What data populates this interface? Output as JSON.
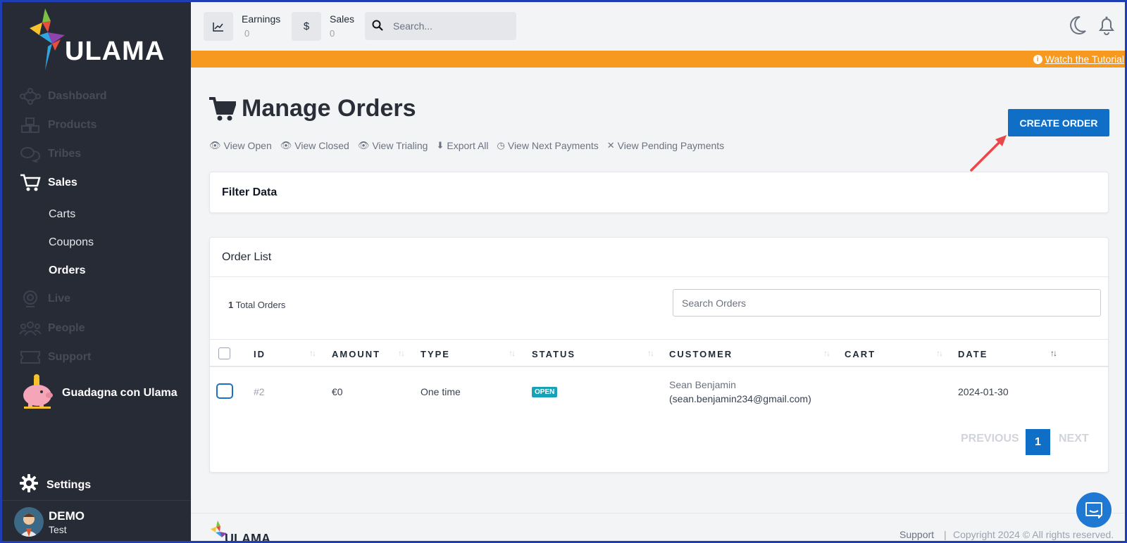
{
  "brand": {
    "name": "ULAMA"
  },
  "sidebar": {
    "items": [
      {
        "label": "Dashboard",
        "icon": "network-icon"
      },
      {
        "label": "Products",
        "icon": "boxes-icon"
      },
      {
        "label": "Tribes",
        "icon": "chat-bubbles-icon"
      },
      {
        "label": "Sales",
        "icon": "cart-icon"
      },
      {
        "label": "Live",
        "icon": "webcam-icon"
      },
      {
        "label": "People",
        "icon": "people-icon"
      },
      {
        "label": "Support",
        "icon": "ticket-icon"
      }
    ],
    "sub_items": [
      "Carts",
      "Coupons",
      "Orders"
    ],
    "promo_label": "Guadagna con Ulama",
    "settings_label": "Settings",
    "user": {
      "name": "DEMO",
      "subtitle": "Test"
    }
  },
  "topbar": {
    "earnings": {
      "title": "Earnings",
      "value": "0"
    },
    "sales": {
      "title": "Sales",
      "value": "0",
      "icon_glyph": "$"
    },
    "search_placeholder": "Search..."
  },
  "banner": {
    "link": "Watch the Tutorial",
    "color": "#f7991f"
  },
  "page": {
    "title": "Manage Orders",
    "links": [
      "View Open",
      "View Closed",
      "View Trialing",
      "Export All",
      "View Next Payments",
      "View Pending Payments"
    ],
    "create_button": "CREATE ORDER"
  },
  "filter": {
    "title": "Filter Data"
  },
  "orders": {
    "title": "Order List",
    "total_count": "1",
    "total_label": "Total Orders",
    "search_placeholder": "Search Orders",
    "columns": [
      "ID",
      "AMOUNT",
      "TYPE",
      "STATUS",
      "CUSTOMER",
      "CART",
      "DATE"
    ],
    "rows": [
      {
        "id": "#2",
        "amount": "€0",
        "type": "One time",
        "status": "OPEN",
        "customer_name": "Sean Benjamin",
        "customer_email": "(sean.benjamin234@gmail.com)",
        "cart": "",
        "date": "2024-01-30"
      }
    ],
    "pagination": {
      "previous": "PREVIOUS",
      "current": "1",
      "next": "NEXT"
    }
  },
  "footer": {
    "support": "Support",
    "separator": "|",
    "copyright": "Copyright 2024 © All rights reserved."
  },
  "colors": {
    "primary": "#0f6fc6",
    "sidebar_bg": "#272b36",
    "status_open": "#17a2b8"
  }
}
